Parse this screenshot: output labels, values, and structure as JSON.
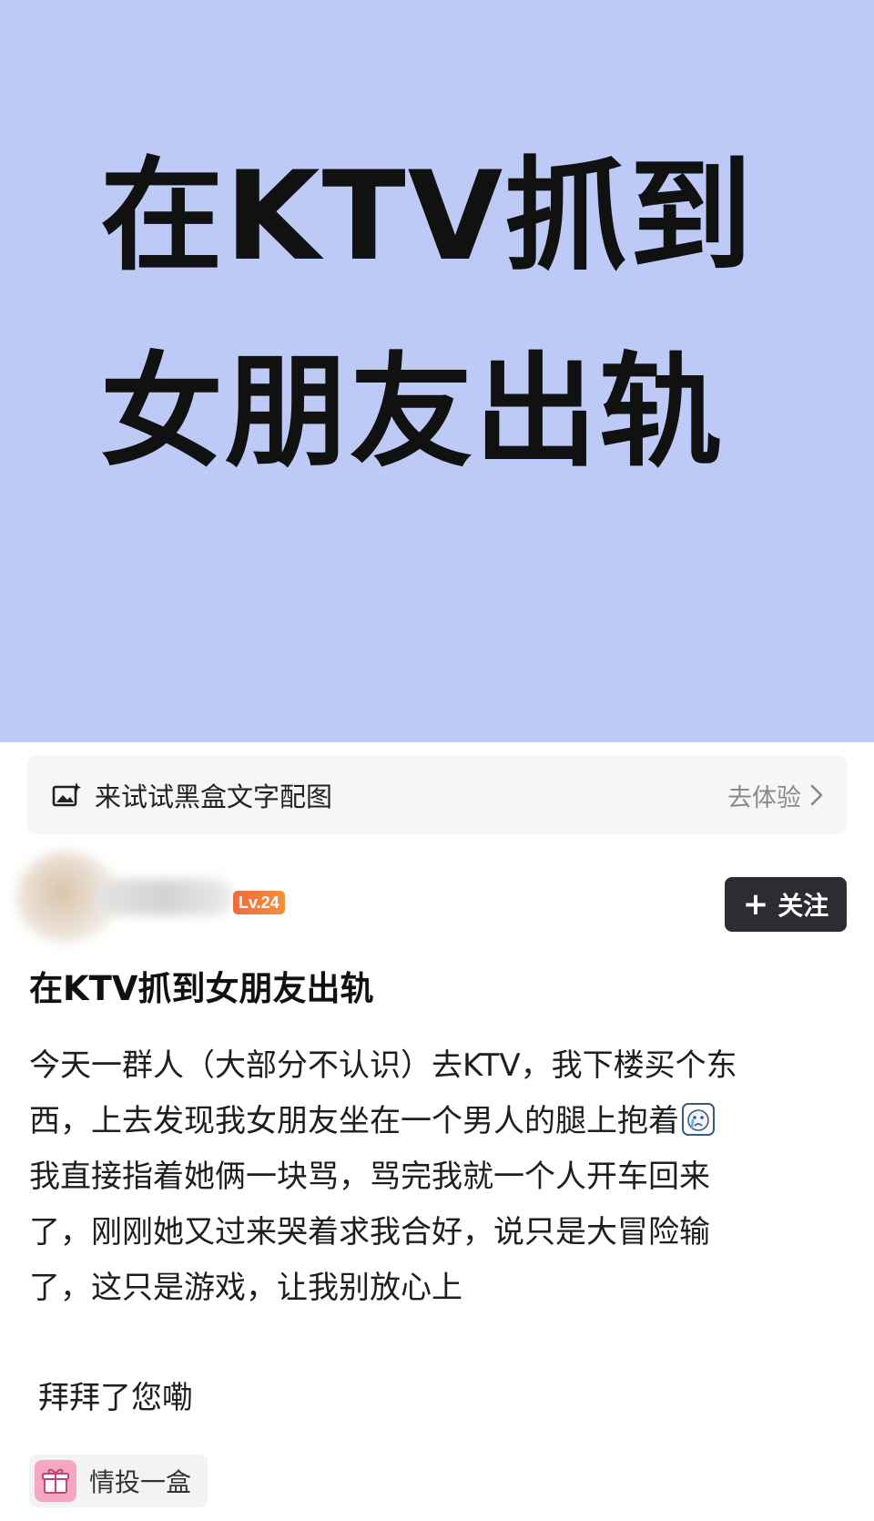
{
  "cover": {
    "title_line1": "在KTV抓到",
    "title_line2": "女朋友出轨",
    "background_color": "#bccaf5"
  },
  "promo": {
    "icon": "image-sparkle-icon",
    "label": "来试试黑盒文字配图",
    "action_label": "去体验",
    "action_icon": "chevron-right-icon"
  },
  "author": {
    "level_badge": "Lv.24",
    "follow_label": "关注",
    "follow_icon": "plus-icon"
  },
  "post": {
    "title": "在KTV抓到女朋友出轨",
    "body_lines": [
      "今天一群人（大部分不认识）去KTV，我下楼买个东",
      "西，上去发现我女朋友坐在一个男人的腿上抱着",
      "我直接指着她俩一块骂，骂完我就一个人开车回来",
      "了，刚刚她又过来哭着求我合好，说只是大冒险输",
      "了，这只是游戏，让我别放心上"
    ],
    "body_emoji": "crying-face-icon",
    "sign_off": "拜拜了您嘞"
  },
  "tag": {
    "icon": "gift-box-icon",
    "label": "情投一盒"
  },
  "colors": {
    "cover_bg": "#bccaf5",
    "follow_bg": "#2c2d30",
    "level_badge": "#f26a3b"
  }
}
